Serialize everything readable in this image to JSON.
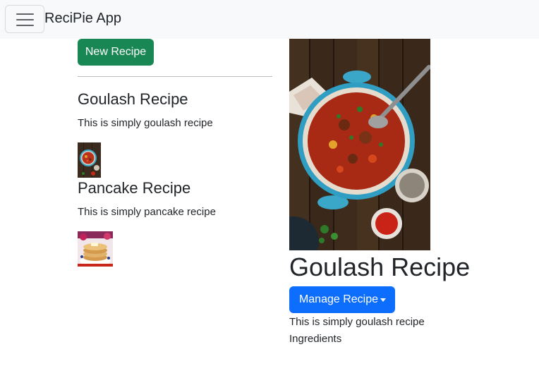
{
  "navbar": {
    "brand": "ReciPie App"
  },
  "sidebar": {
    "new_recipe_label": "New Recipe",
    "recipes": [
      {
        "title": "Goulash Recipe",
        "description": "This is simply goulash recipe"
      },
      {
        "title": "Pancake Recipe",
        "description": "This is simply pancake recipe"
      }
    ]
  },
  "detail": {
    "title": "Goulash Recipe",
    "manage_label": "Manage Recipe",
    "description": "This is simply goulash recipe",
    "ingredients_label": "Ingredients"
  },
  "colors": {
    "success": "#198754",
    "primary": "#0d6efd",
    "navbar_bg": "#f8f9fa"
  }
}
